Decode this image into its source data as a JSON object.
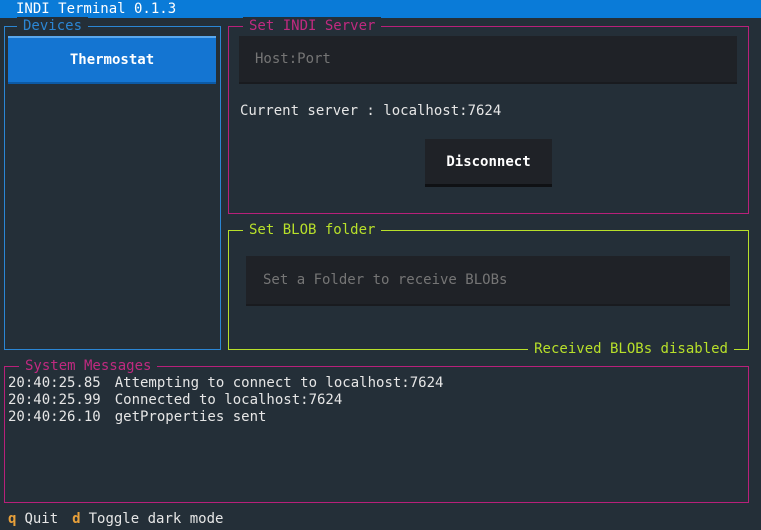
{
  "app": {
    "title": "INDI Terminal 0.1.3"
  },
  "devices": {
    "title": "Devices",
    "items": [
      {
        "label": "Thermostat"
      }
    ]
  },
  "indi_server": {
    "title": "Set INDI Server",
    "host_placeholder": "Host:Port",
    "current_server": "Current server : localhost:7624",
    "disconnect_label": "Disconnect"
  },
  "blob": {
    "title": "Set BLOB folder",
    "folder_placeholder": "Set a Folder to receive BLOBs",
    "status": "Received BLOBs disabled"
  },
  "system_messages": {
    "title": "System Messages",
    "messages": [
      {
        "time": "20:40:25.85",
        "text": "Attempting to connect to localhost:7624"
      },
      {
        "time": "20:40:25.99",
        "text": "Connected to localhost:7624"
      },
      {
        "time": "20:40:26.10",
        "text": "getProperties sent"
      }
    ]
  },
  "footer": {
    "bindings": [
      {
        "key": "q",
        "label": "Quit"
      },
      {
        "key": "d",
        "label": "Toggle dark mode"
      }
    ]
  },
  "colors": {
    "titlebar": "#0a7bd8",
    "background": "#242f38",
    "devices_border": "#2b86d4",
    "server_border": "#b8207a",
    "blob_border": "#b8e02a",
    "key_accent": "#e8a03a"
  }
}
